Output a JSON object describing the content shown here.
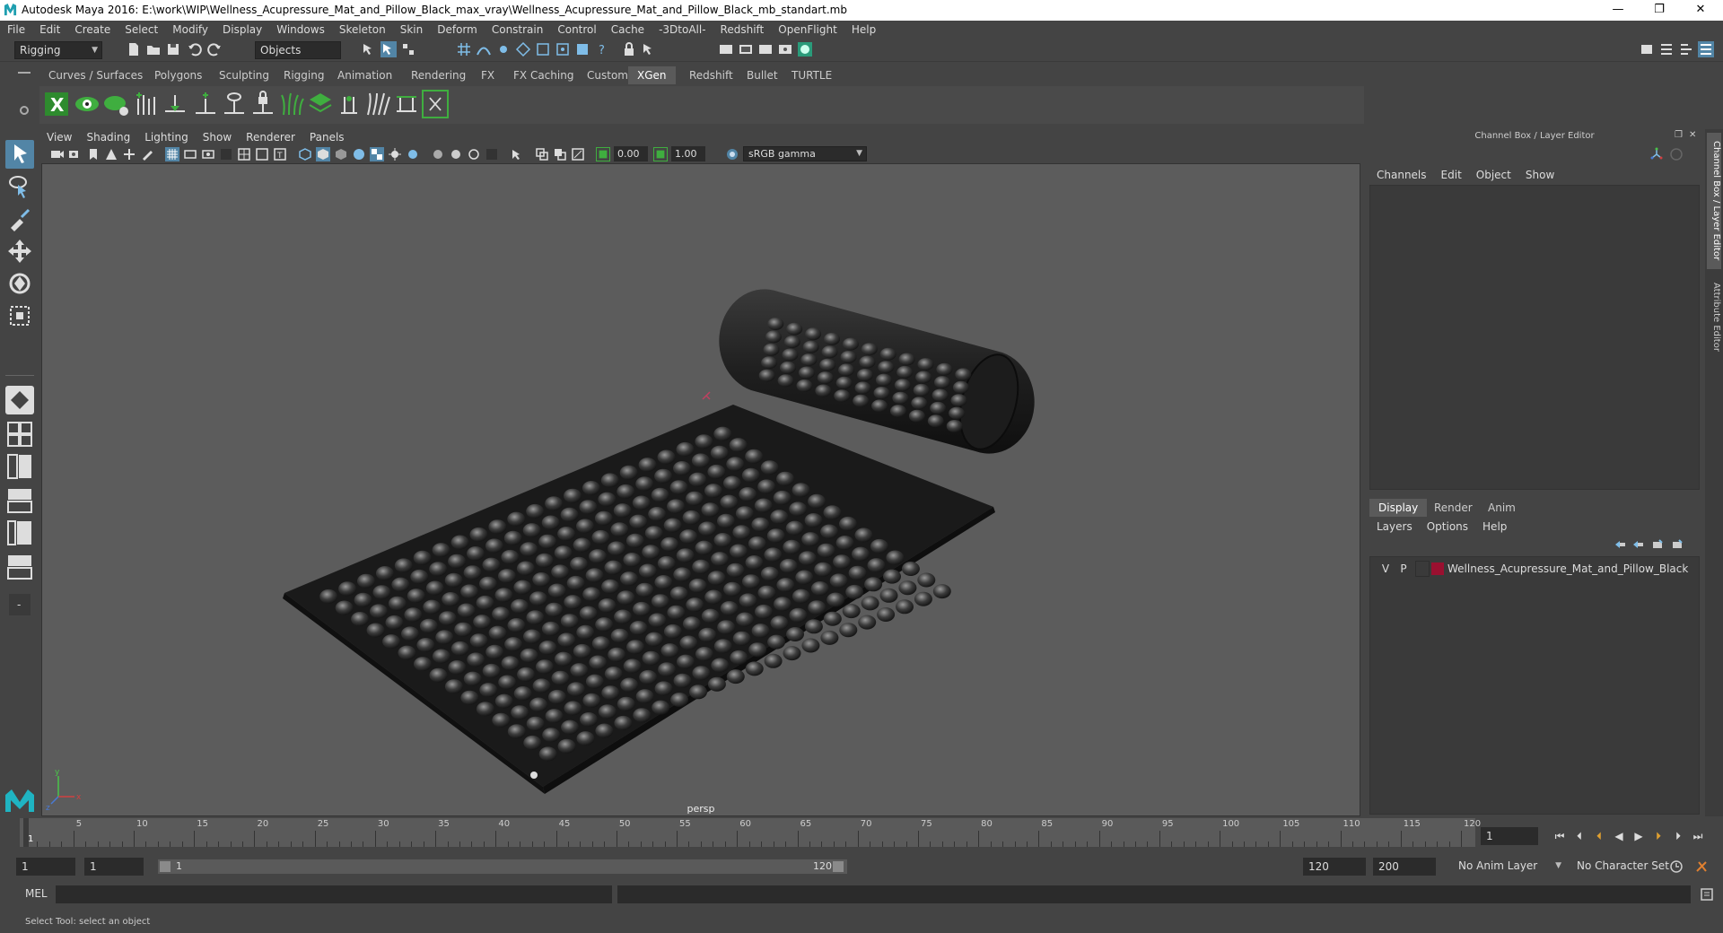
{
  "window": {
    "title": "Autodesk Maya 2016: E:\\work\\WIP\\Wellness_Acupressure_Mat_and_Pillow_Black_max_vray\\Wellness_Acupressure_Mat_and_Pillow_Black_mb_standart.mb",
    "minimize": "—",
    "restore": "❐",
    "close": "✕"
  },
  "menubar": [
    "File",
    "Edit",
    "Create",
    "Select",
    "Modify",
    "Display",
    "Windows",
    "Skeleton",
    "Skin",
    "Deform",
    "Constrain",
    "Control",
    "Cache",
    "-3DtoAll-",
    "Redshift",
    "OpenFlight",
    "Help"
  ],
  "statusline": {
    "mode": "Rigging",
    "selection_mode": "Objects"
  },
  "shelf_tabs": [
    "Curves / Surfaces",
    "Polygons",
    "Sculpting",
    "Rigging",
    "Animation",
    "Rendering",
    "FX",
    "FX Caching",
    "Custom",
    "XGen",
    "Redshift",
    "Bullet",
    "TURTLE"
  ],
  "shelf_active": "XGen",
  "viewport": {
    "menus": [
      "View",
      "Shading",
      "Lighting",
      "Show",
      "Renderer",
      "Panels"
    ],
    "exposure": "0.00",
    "gamma": "1.00",
    "color_space": "sRGB gamma",
    "camera": "persp"
  },
  "channel_box": {
    "title": "Channel Box / Layer Editor",
    "menus": [
      "Channels",
      "Edit",
      "Object",
      "Show"
    ]
  },
  "layer_editor": {
    "tabs": [
      "Display",
      "Render",
      "Anim"
    ],
    "active_tab": "Display",
    "menus": [
      "Layers",
      "Options",
      "Help"
    ],
    "layers": [
      {
        "visible": "V",
        "playback": "P",
        "name": "Wellness_Acupressure_Mat_and_Pillow_Black",
        "color": "#9a1030"
      }
    ]
  },
  "side_tabs": [
    "Channel Box / Layer Editor",
    "Attribute Editor"
  ],
  "timeline": {
    "start": 1,
    "end": 120,
    "tick_labels": [
      "1",
      "5",
      "10",
      "15",
      "20",
      "25",
      "30",
      "35",
      "40",
      "45",
      "50",
      "55",
      "60",
      "65",
      "70",
      "75",
      "80",
      "85",
      "90",
      "95",
      "100",
      "105",
      "110",
      "115",
      "120"
    ],
    "current_frame": "1"
  },
  "range": {
    "start_field": "1",
    "start_field2": "1",
    "slider_start": "1",
    "slider_end": "120",
    "end_field": "120",
    "end_field2": "200",
    "anim_layer": "No Anim Layer",
    "character_set": "No Character Set"
  },
  "command_line": {
    "label": "MEL"
  },
  "help_line": "Select Tool: select an object",
  "colors": {
    "accent": "#5285a6",
    "xgen_green": "#3fae3f"
  }
}
